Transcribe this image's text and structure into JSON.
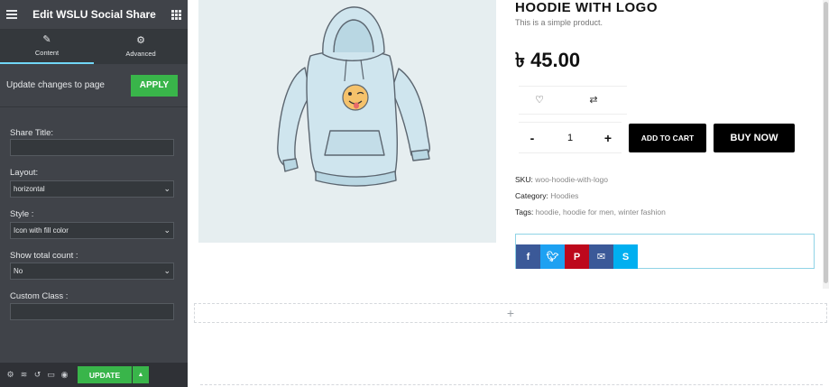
{
  "panel": {
    "title": "Edit WSLU Social Share",
    "tabs": [
      {
        "label": "Content",
        "icon": "pencil-icon"
      },
      {
        "label": "Advanced",
        "icon": "gear-icon"
      }
    ],
    "update_prompt": "Update changes to page",
    "apply_label": "APPLY",
    "fields": {
      "share_title": {
        "label": "Share Title:",
        "value": ""
      },
      "layout": {
        "label": "Layout:",
        "value": "horizontal"
      },
      "style": {
        "label": "Style :",
        "value": "Icon with fill color"
      },
      "show_total_count": {
        "label": "Show total count :",
        "value": "No"
      },
      "custom_class": {
        "label": "Custom Class :",
        "value": ""
      }
    },
    "footer": {
      "update_label": "UPDATE"
    },
    "colors": {
      "panel_bg": "#404349",
      "accent": "#39b54a",
      "tab_underline": "#71d7f7"
    }
  },
  "product": {
    "title": "HOODIE WITH LOGO",
    "description": "This is a simple product.",
    "price": "৳ 45.00",
    "quantity": "1",
    "add_to_cart_label": "ADD TO CART",
    "buy_now_label": "BUY NOW",
    "sku_label": "SKU:",
    "sku_value": "woo-hoodie-with-logo",
    "category_label": "Category:",
    "category_value": "Hoodies",
    "tags_label": "Tags:",
    "tags_value": "hoodie, hoodie for men, winter fashion"
  },
  "share_buttons": [
    {
      "name": "facebook",
      "glyph": "f",
      "color": "#3b5998"
    },
    {
      "name": "twitter",
      "glyph": "t",
      "color": "#1da1f2"
    },
    {
      "name": "pinterest",
      "glyph": "P",
      "color": "#bd081c"
    },
    {
      "name": "messenger",
      "glyph": "m",
      "color": "#3b5998"
    },
    {
      "name": "skype",
      "glyph": "S",
      "color": "#00aff0"
    }
  ],
  "add_section_glyph": "+"
}
